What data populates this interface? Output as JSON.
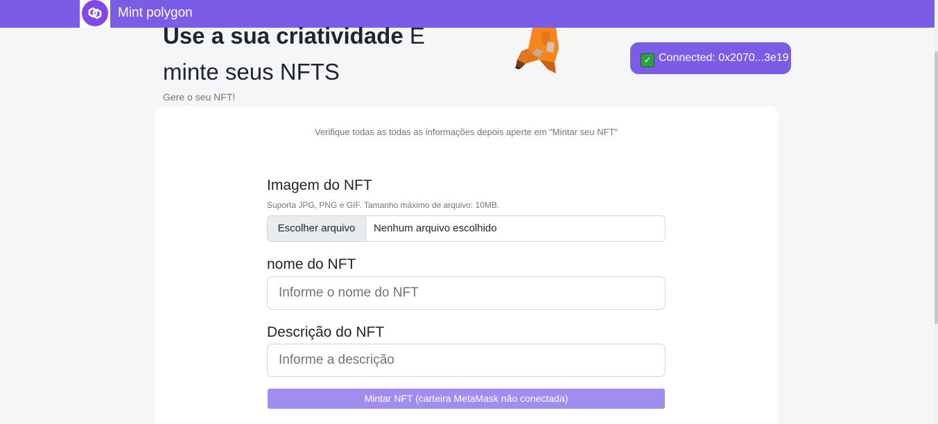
{
  "navbar": {
    "brand": "Mint polygon",
    "logo_icon": "polygon-logo-icon",
    "bg_color": "#7b5ce6"
  },
  "hero": {
    "title_bold": "Use a sua criatividade",
    "title_rest": " E",
    "title_line2": "minte seus NFTS",
    "subtitle": "Gere o seu NFT!"
  },
  "wallet": {
    "icon": "check-icon",
    "label": "Connected: 0x2070...3e19"
  },
  "card": {
    "hint": "Verifique todas as todas as informações depois aperte em \"Mintar seu NFT\"",
    "image_field": {
      "label": "Imagem do NFT",
      "help": "Suporta JPG, PNG e GIF. Tamanho máximo de arquivo: 10MB.",
      "button_label": "Escolher arquivo",
      "file_status": "Nenhum arquivo escolhido"
    },
    "name_field": {
      "label": "nome do NFT",
      "placeholder": "Informe o nome do NFT"
    },
    "description_field": {
      "label": "Descrição do NFT",
      "placeholder": "Informe a descrição"
    },
    "mint_button": "Mintar NFT (carteira MetaMask não conectada)"
  },
  "colors": {
    "accent": "#7b5ce6",
    "mint_button_disabled": "#a18cf0",
    "page_bg": "#f4f6f8"
  }
}
